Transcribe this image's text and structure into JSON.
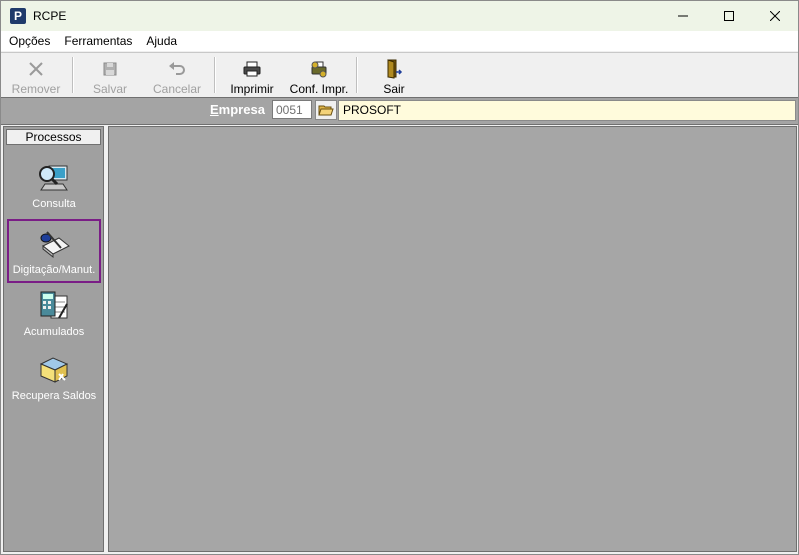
{
  "window": {
    "title": "RCPE",
    "app_icon_letter": "P"
  },
  "menu": {
    "items": [
      "Opções",
      "Ferramentas",
      "Ajuda"
    ]
  },
  "toolbar": {
    "remover": "Remover",
    "salvar": "Salvar",
    "cancelar": "Cancelar",
    "imprimir": "Imprimir",
    "conf_impr": "Conf. Impr.",
    "sair": "Sair"
  },
  "empresa": {
    "label_first": "E",
    "label_rest": "mpresa",
    "code": "0051",
    "name": "PROSOFT"
  },
  "panel": {
    "header": "Processos",
    "items": [
      {
        "label": "Consulta"
      },
      {
        "label": "Digitação/Manut."
      },
      {
        "label": "Acumulados"
      },
      {
        "label": "Recupera Saldos"
      }
    ]
  }
}
